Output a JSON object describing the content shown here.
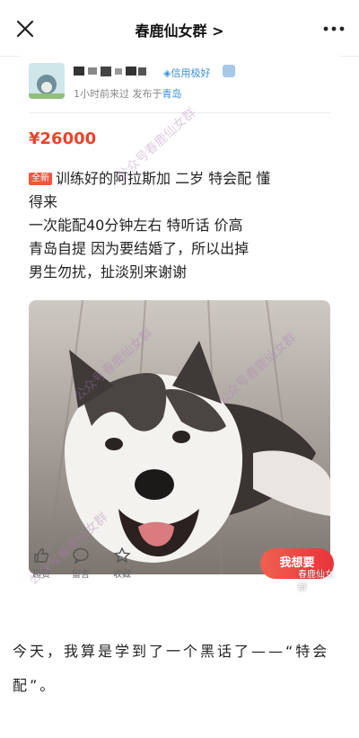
{
  "navbar": {
    "title": "春鹿仙女群 >"
  },
  "post": {
    "credit": "信用极好",
    "meta_time": "1小时前来过",
    "meta_pub": "发布于",
    "meta_loc": "青岛",
    "price": "¥26000",
    "tag": "全新",
    "desc_lines": [
      "训练好的阿拉斯加 二岁 特会配 懂",
      "得来",
      "一次能配40分钟左右 特听话 价高",
      "青岛自提 因为要结婚了，所以出掉",
      "男生勿扰，扯淡别来谢谢"
    ]
  },
  "actions": {
    "like": "超赞",
    "comment": "留言",
    "fav": "收藏",
    "want": "我想要"
  },
  "watermark": {
    "text": "公众号春鹿仙女群",
    "small": "春鹿仙女群"
  },
  "article": {
    "text": "今天，我算是学到了一个黑话了——“特会配”。"
  },
  "colors": {
    "price": "#e8442c",
    "accent": "#3a8fd6",
    "button": "#e8343a"
  }
}
